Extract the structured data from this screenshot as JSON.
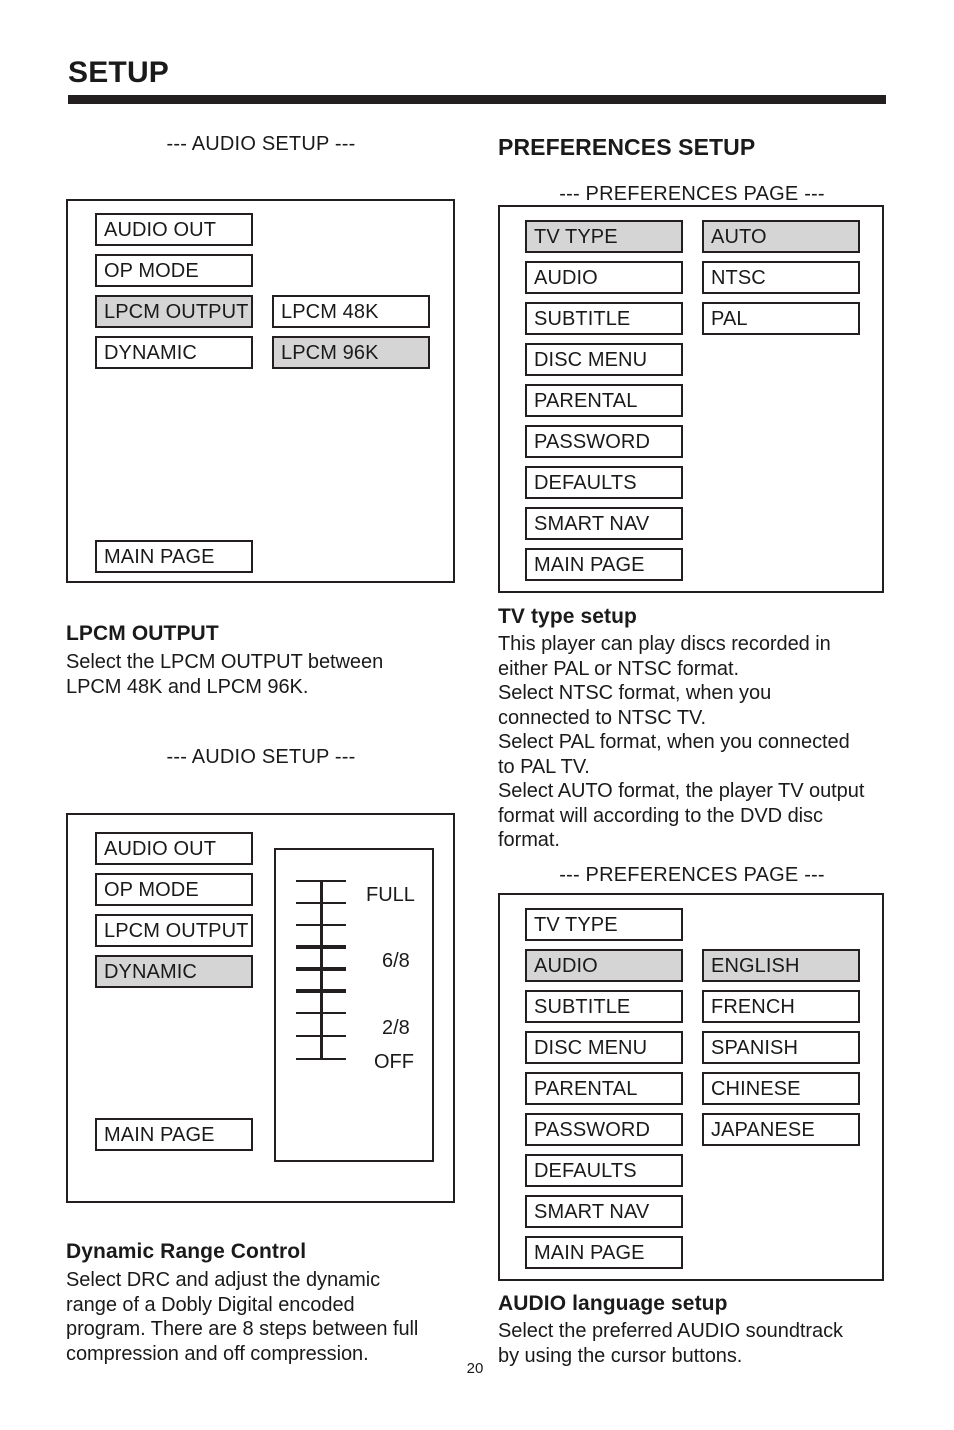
{
  "page": {
    "title": "SETUP",
    "number": "20"
  },
  "left_column": {
    "audio_caption_1": "--- AUDIO SETUP ---",
    "panel1": {
      "menu": [
        "AUDIO OUT",
        "OP MODE",
        "LPCM OUTPUT",
        "DYNAMIC"
      ],
      "menu_selected_index": 2,
      "main_page": "MAIN PAGE",
      "options": [
        "LPCM 48K",
        "LPCM 96K"
      ],
      "options_selected_index": 1
    },
    "lpcm_section": {
      "heading": "LPCM OUTPUT",
      "lines": [
        "Select the LPCM OUTPUT between",
        "LPCM 48K and LPCM 96K."
      ]
    },
    "audio_caption_2": "--- AUDIO SETUP ---",
    "panel2": {
      "menu": [
        "AUDIO OUT",
        "OP MODE",
        "LPCM OUTPUT",
        "DYNAMIC"
      ],
      "menu_selected_index": 3,
      "main_page": "MAIN PAGE",
      "slider": {
        "labels": [
          "FULL",
          "6/8",
          "2/8",
          "OFF"
        ],
        "tick_count": 9,
        "thick_tick_indexes": [
          3,
          4,
          5
        ]
      }
    },
    "drc_section": {
      "heading": "Dynamic Range Control",
      "lines": [
        "Select DRC and adjust the dynamic",
        "range of a Dobly Digital encoded",
        "program.  There are 8 steps between full",
        "compression and off compression."
      ]
    }
  },
  "right_column": {
    "heading": "PREFERENCES SETUP",
    "prefs_caption_1": "--- PREFERENCES PAGE ---",
    "panel3": {
      "menu": [
        "TV TYPE",
        "AUDIO",
        "SUBTITLE",
        "DISC MENU",
        "PARENTAL",
        "PASSWORD",
        "DEFAULTS",
        "SMART NAV",
        "MAIN PAGE"
      ],
      "menu_selected_index": 0,
      "options": [
        "AUTO",
        "NTSC",
        "PAL"
      ],
      "options_selected_index": 0
    },
    "tvtype_section": {
      "heading": "TV type setup",
      "lines": [
        "This player can play discs recorded in",
        "either PAL or NTSC format.",
        "Select NTSC format, when you",
        "connected to NTSC TV.",
        "Select PAL format, when you connected",
        "to PAL TV.",
        "Select AUTO format, the player TV output",
        "format will according to the DVD disc",
        "format."
      ]
    },
    "prefs_caption_2": "--- PREFERENCES PAGE ---",
    "panel4": {
      "menu": [
        "TV TYPE",
        "AUDIO",
        "SUBTITLE",
        "DISC MENU",
        "PARENTAL",
        "PASSWORD",
        "DEFAULTS",
        "SMART NAV",
        "MAIN PAGE"
      ],
      "menu_selected_index": 1,
      "options": [
        "ENGLISH",
        "FRENCH",
        "SPANISH",
        "CHINESE",
        "JAPANESE"
      ],
      "options_selected_index": 0
    },
    "audio_lang_section": {
      "heading": "AUDIO language setup",
      "lines": [
        "Select the preferred AUDIO soundtrack",
        "by using the cursor buttons."
      ]
    }
  }
}
